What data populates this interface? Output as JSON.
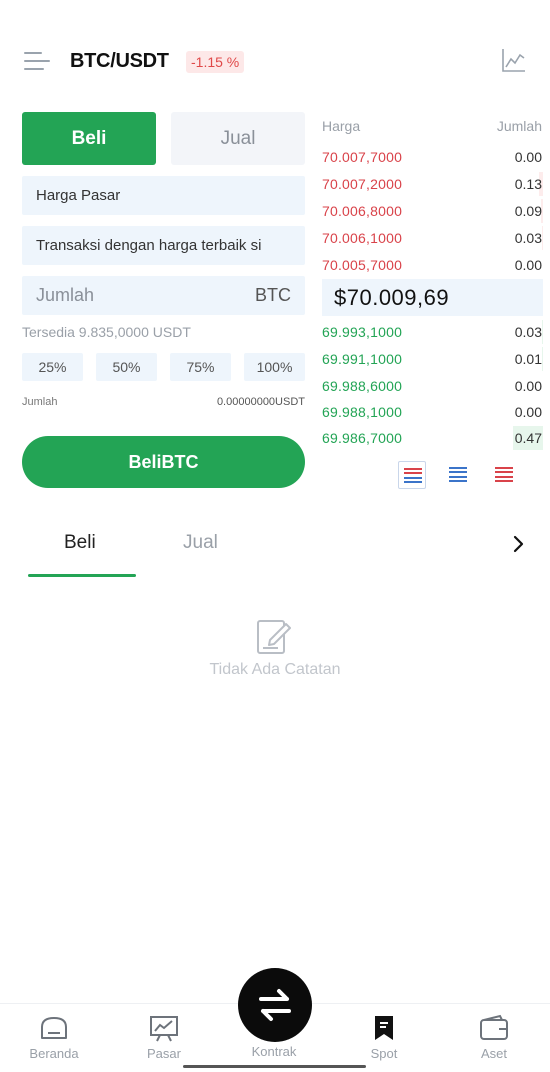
{
  "header": {
    "pair": "BTC/USDT",
    "change": "-1.15 %",
    "menu_icon": "menu-icon",
    "chart_icon": "line-chart-icon",
    "change_color": "#e04848"
  },
  "trade": {
    "buy_tab": "Beli",
    "sell_tab": "Jual",
    "order_type": "Harga Pasar",
    "note": "Transaksi dengan harga terbaik si",
    "amount_placeholder": "Jumlah",
    "amount_unit": "BTC",
    "available": "Tersedia 9.835,0000 USDT",
    "percents": [
      "25%",
      "50%",
      "75%",
      "100%"
    ],
    "total_label": "Jumlah",
    "total_value": "0.00000000USDT",
    "submit": "BeliBTC",
    "accent": "#23a455"
  },
  "orderbook": {
    "price_header": "Harga",
    "qty_header": "Jumlah",
    "asks": [
      {
        "price": "70.007,7000",
        "qty": "0.00",
        "depth": 0.0
      },
      {
        "price": "70.007,2000",
        "qty": "0.13",
        "depth": 0.12
      },
      {
        "price": "70.006,8000",
        "qty": "0.09",
        "depth": 0.08
      },
      {
        "price": "70.006,1000",
        "qty": "0.03",
        "depth": 0.03
      },
      {
        "price": "70.005,7000",
        "qty": "0.00",
        "depth": 0.0
      }
    ],
    "last_price": "$70.009,69",
    "bids": [
      {
        "price": "69.993,1000",
        "qty": "0.03",
        "depth": 0.03
      },
      {
        "price": "69.991,1000",
        "qty": "0.01",
        "depth": 0.02
      },
      {
        "price": "69.988,6000",
        "qty": "0.00",
        "depth": 0.0
      },
      {
        "price": "69.988,1000",
        "qty": "0.00",
        "depth": 0.0
      },
      {
        "price": "69.986,7000",
        "qty": "0.47",
        "depth": 1.0
      }
    ],
    "ask_color": "#d9434a",
    "bid_color": "#23a455"
  },
  "history": {
    "tab_buy": "Beli",
    "tab_sell": "Jual",
    "empty": "Tidak Ada Catatan"
  },
  "nav": {
    "items": [
      {
        "label": "Beranda",
        "icon": "home-icon"
      },
      {
        "label": "Pasar",
        "icon": "market-chart-icon"
      },
      {
        "label": "Kontrak",
        "icon": "swap-icon"
      },
      {
        "label": "Spot",
        "icon": "bookmark-icon"
      },
      {
        "label": "Aset",
        "icon": "wallet-icon"
      }
    ]
  }
}
